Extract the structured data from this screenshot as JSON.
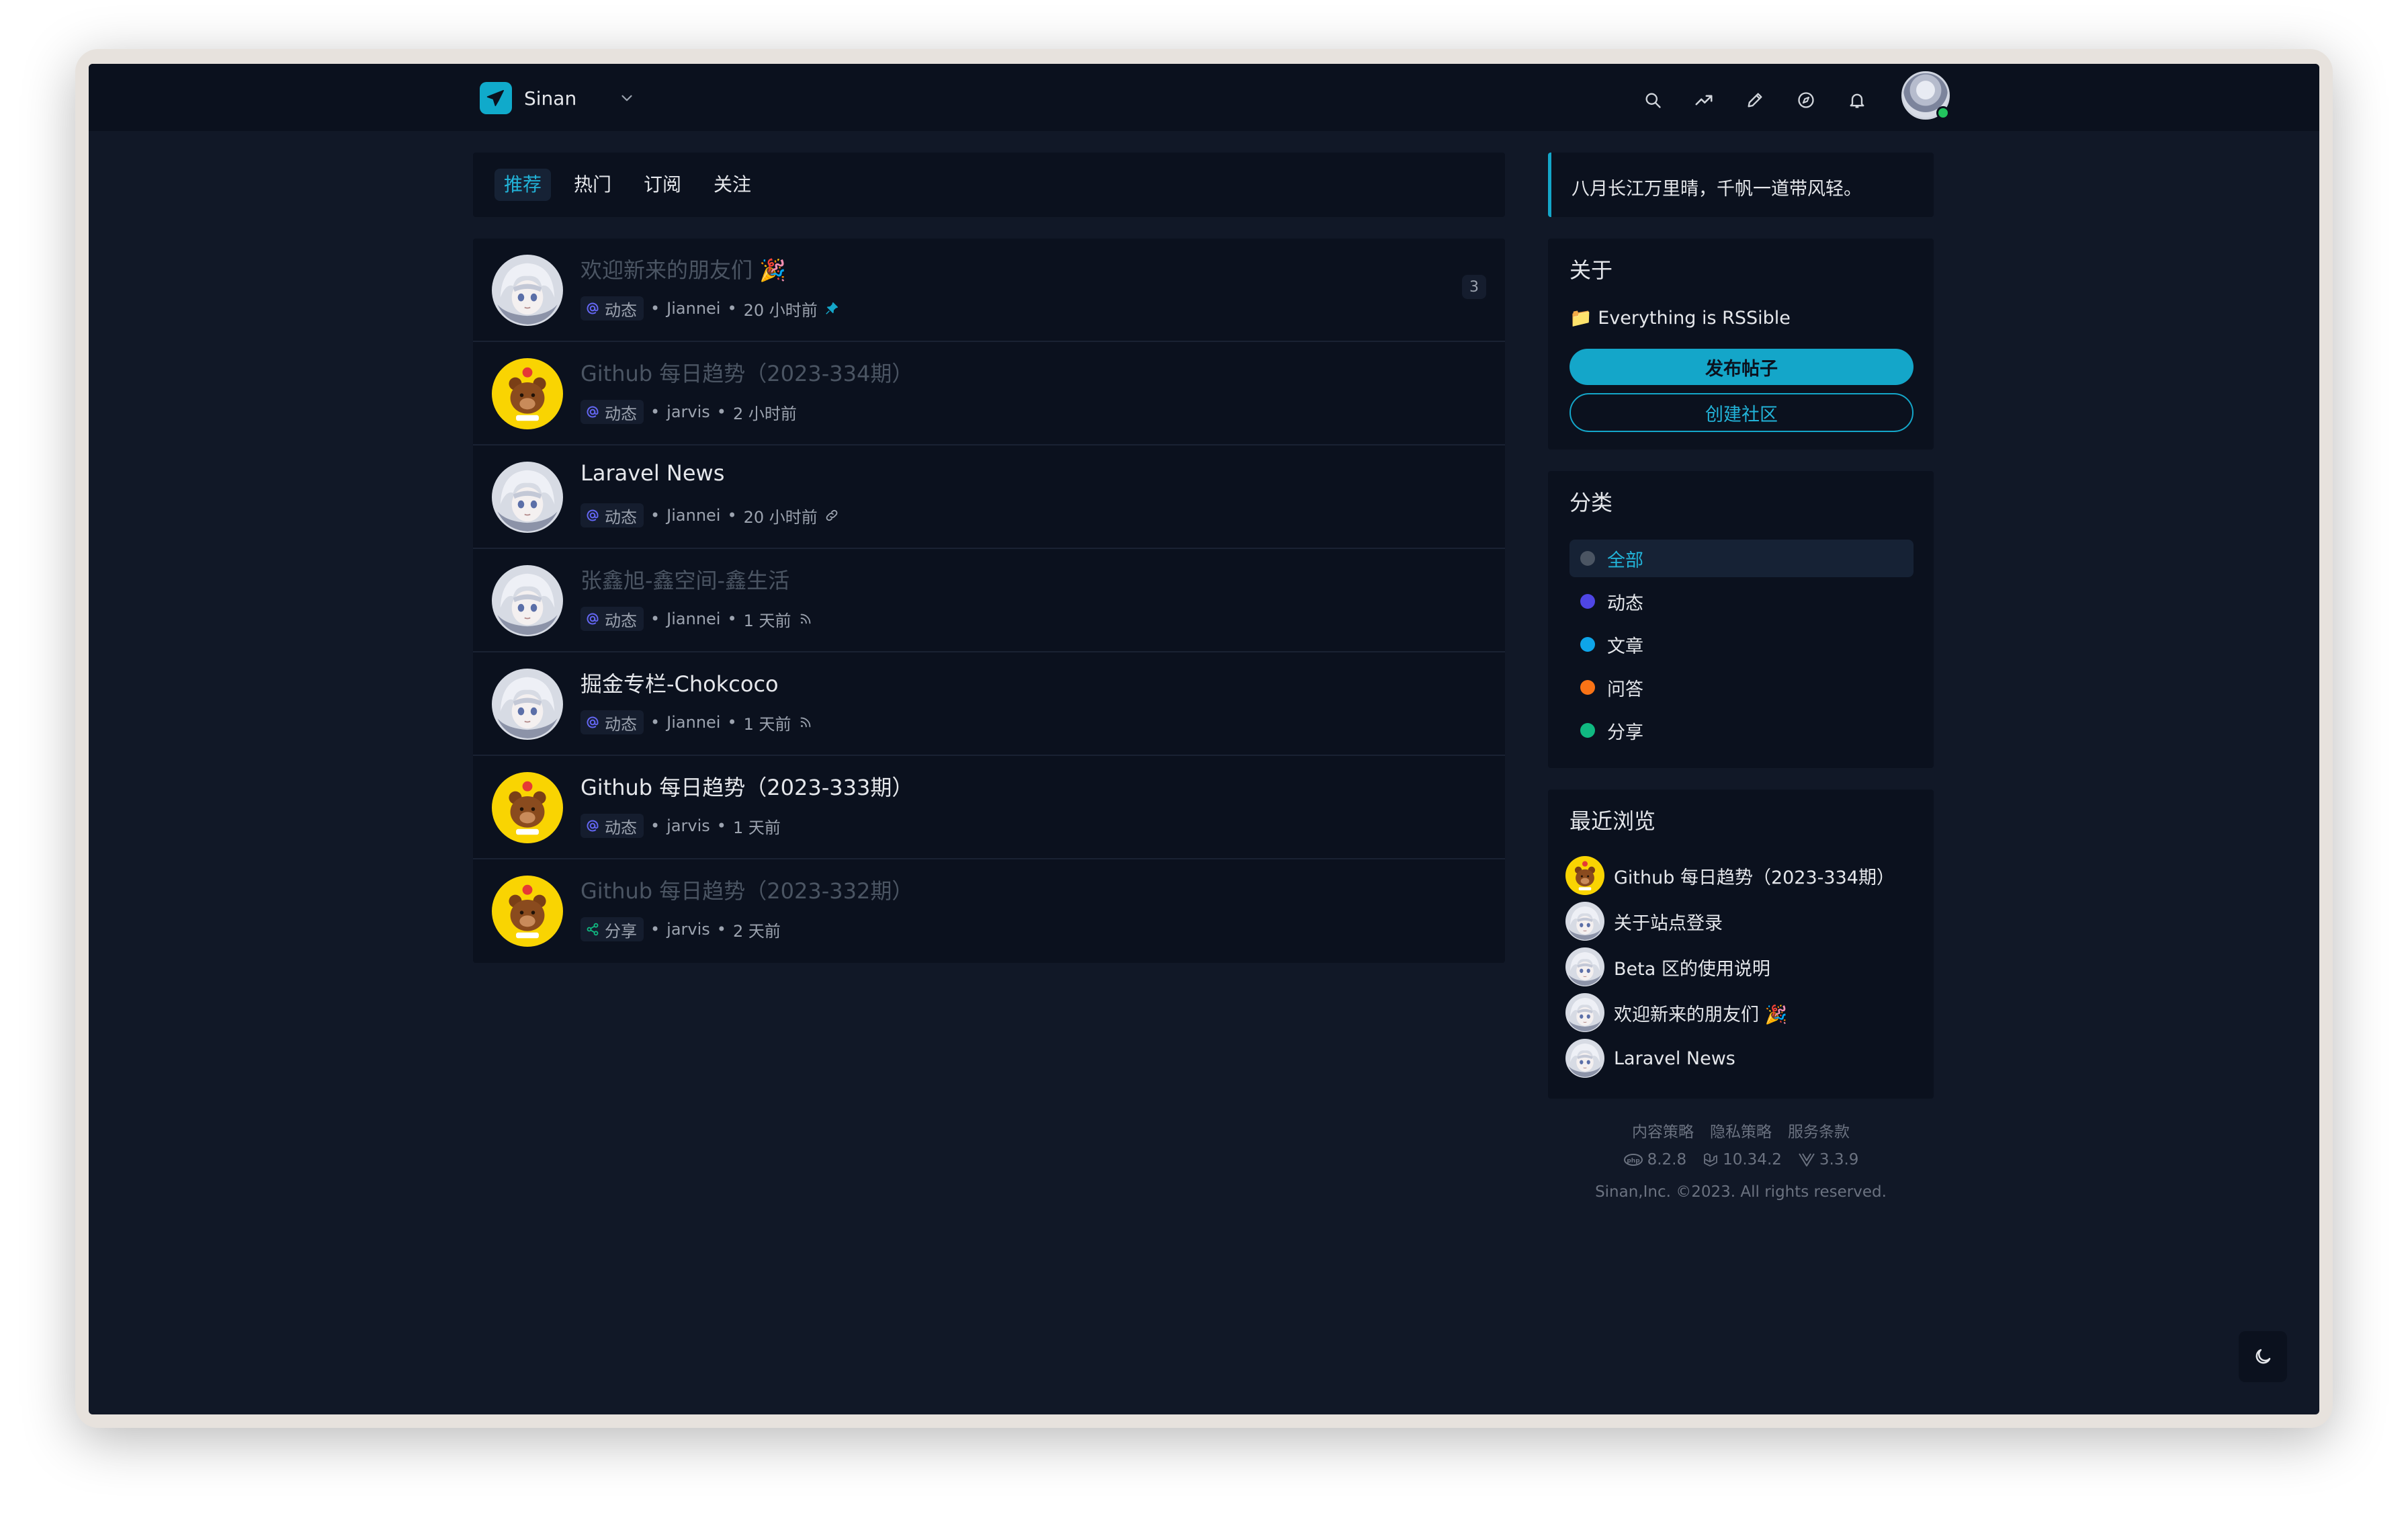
{
  "header": {
    "brand_name": "Sinan",
    "icons": [
      "search-icon",
      "trending-icon",
      "edit-icon",
      "compass-icon",
      "bell-icon"
    ]
  },
  "tabs": [
    {
      "label": "推荐",
      "active": true
    },
    {
      "label": "热门",
      "active": false
    },
    {
      "label": "订阅",
      "active": false
    },
    {
      "label": "关注",
      "active": false
    }
  ],
  "feed": [
    {
      "title": "欢迎新来的朋友们 🎉",
      "dim": true,
      "avatar": "anime",
      "category": "动态",
      "category_icon": "at-icon",
      "author": "Jiannei",
      "time": "20 小时前",
      "extra_icon": "pin-icon",
      "count": "3"
    },
    {
      "title": "Github 每日趋势（2023-334期）",
      "dim": true,
      "avatar": "bear",
      "category": "动态",
      "category_icon": "at-icon",
      "author": "jarvis",
      "time": "2 小时前",
      "extra_icon": "",
      "count": ""
    },
    {
      "title": "Laravel News",
      "dim": false,
      "avatar": "anime",
      "category": "动态",
      "category_icon": "at-icon",
      "author": "Jiannei",
      "time": "20 小时前",
      "extra_icon": "link-icon",
      "count": ""
    },
    {
      "title": "张鑫旭-鑫空间-鑫生活",
      "dim": true,
      "avatar": "anime",
      "category": "动态",
      "category_icon": "at-icon",
      "author": "Jiannei",
      "time": "1 天前",
      "extra_icon": "rss-icon",
      "count": ""
    },
    {
      "title": "掘金专栏-Chokcoco",
      "dim": false,
      "avatar": "anime",
      "category": "动态",
      "category_icon": "at-icon",
      "author": "Jiannei",
      "time": "1 天前",
      "extra_icon": "rss-icon",
      "count": ""
    },
    {
      "title": "Github 每日趋势（2023-333期）",
      "dim": false,
      "avatar": "bear",
      "category": "动态",
      "category_icon": "at-icon",
      "author": "jarvis",
      "time": "1 天前",
      "extra_icon": "",
      "count": ""
    },
    {
      "title": "Github 每日趋势（2023-332期）",
      "dim": true,
      "avatar": "bear",
      "category": "分享",
      "category_icon": "share-icon",
      "author": "jarvis",
      "time": "2 天前",
      "extra_icon": "",
      "count": ""
    }
  ],
  "sidebar": {
    "quote": "八月长江万里晴，千帆一道带风轻。",
    "about": {
      "title": "关于",
      "text": "📁 Everything is RSSible",
      "publish_button": "发布帖子",
      "create_button": "创建社区"
    },
    "categories": {
      "title": "分类",
      "items": [
        {
          "label": "全部",
          "color": "#4b5563",
          "active": true
        },
        {
          "label": "动态",
          "color": "#4f46e5",
          "active": false
        },
        {
          "label": "文章",
          "color": "#0ea5e9",
          "active": false
        },
        {
          "label": "问答",
          "color": "#f97316",
          "active": false
        },
        {
          "label": "分享",
          "color": "#10b981",
          "active": false
        }
      ]
    },
    "recent": {
      "title": "最近浏览",
      "items": [
        {
          "label": "Github 每日趋势（2023-334期）",
          "avatar": "bear"
        },
        {
          "label": "关于站点登录",
          "avatar": "anime"
        },
        {
          "label": "Beta 区的使用说明",
          "avatar": "anime"
        },
        {
          "label": "欢迎新来的朋友们 🎉",
          "avatar": "anime"
        },
        {
          "label": "Laravel News",
          "avatar": "anime"
        }
      ]
    }
  },
  "footer": {
    "links": [
      "内容策略",
      "隐私策略",
      "服务条款"
    ],
    "versions": [
      {
        "icon": "php-icon",
        "value": "8.2.8"
      },
      {
        "icon": "laravel-icon",
        "value": "10.34.2"
      },
      {
        "icon": "vue-icon",
        "value": "3.3.9"
      }
    ],
    "copyright": "Sinan,Inc. ©2023. All rights reserved."
  },
  "colors": {
    "accent": "#14a6c9",
    "background": "#111827",
    "card": "#0b111e"
  }
}
